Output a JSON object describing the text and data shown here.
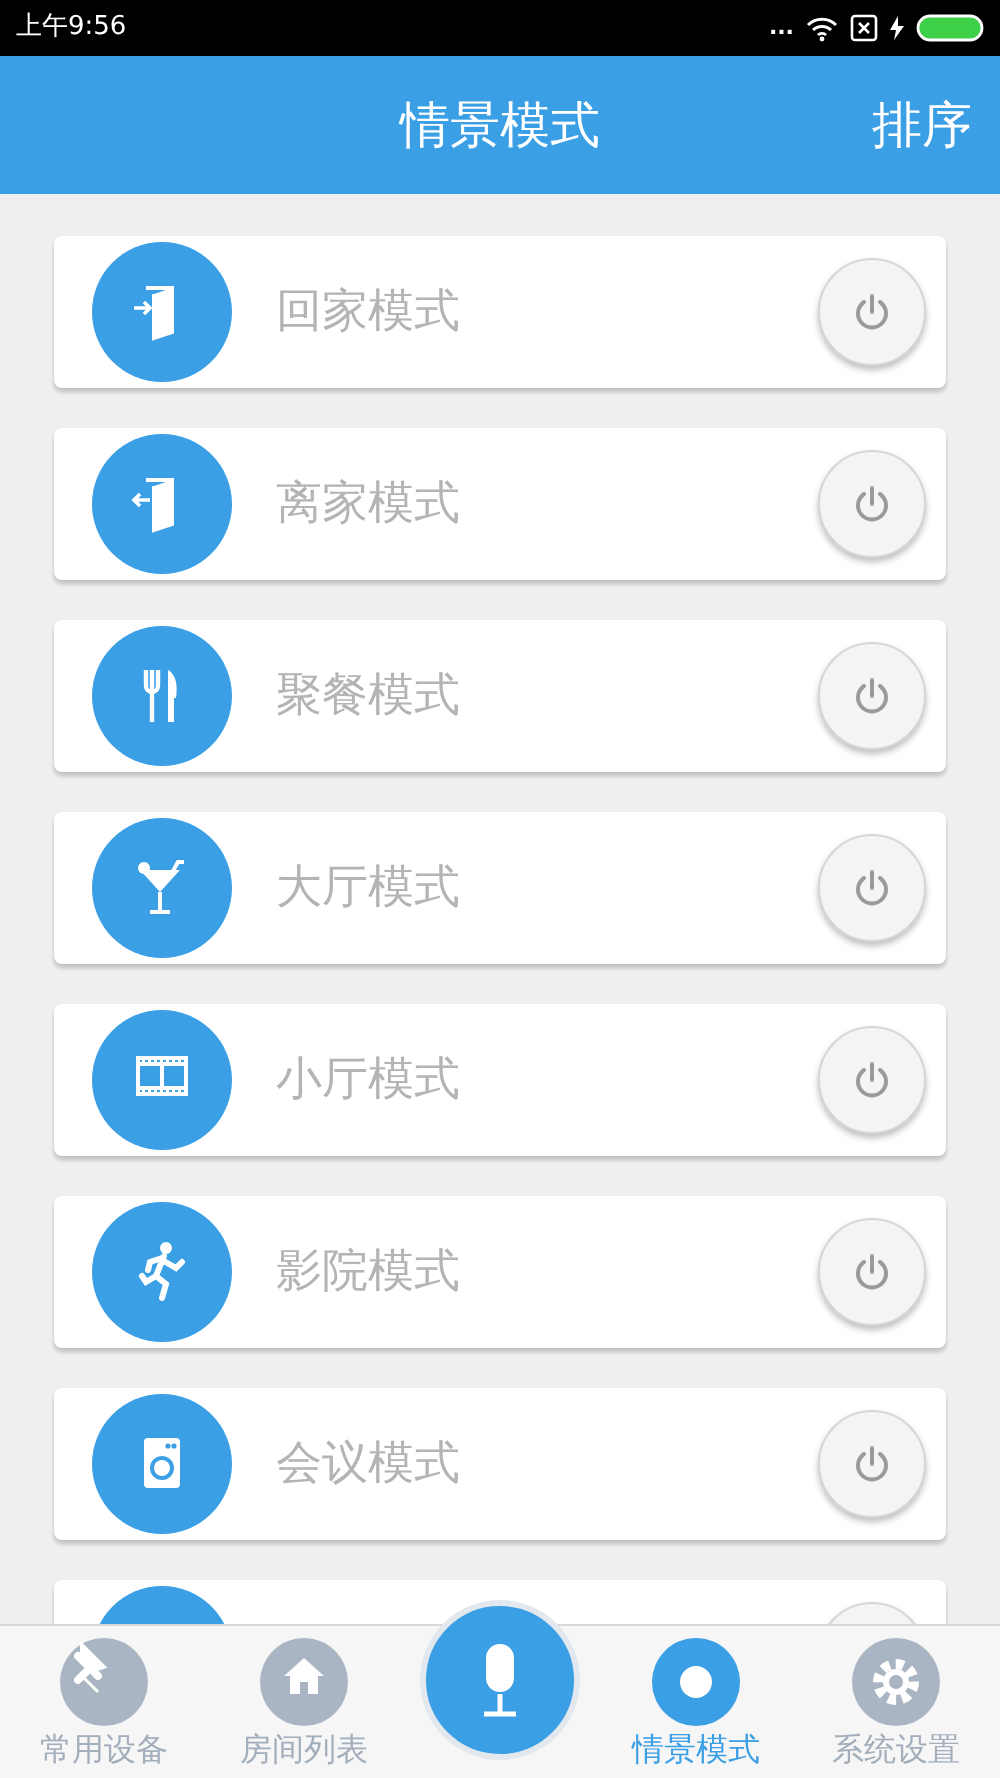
{
  "status_bar": {
    "time": "上午9:56",
    "dots": "..."
  },
  "header": {
    "title": "情景模式",
    "action": "排序"
  },
  "scenes": [
    {
      "label": "回家模式",
      "on": false
    },
    {
      "label": "离家模式",
      "on": false
    },
    {
      "label": "聚餐模式",
      "on": false
    },
    {
      "label": "大厅模式",
      "on": false
    },
    {
      "label": "小厅模式",
      "on": false
    },
    {
      "label": "影院模式",
      "on": false
    },
    {
      "label": "会议模式",
      "on": false
    },
    {
      "on": false
    }
  ],
  "tabs": [
    {
      "kind": "tab",
      "label": "常用设备",
      "selected": false
    },
    {
      "kind": "tab",
      "label": "房间列表",
      "selected": false
    },
    {
      "kind": "center"
    },
    {
      "kind": "tab",
      "label": "情景模式",
      "selected": true
    },
    {
      "kind": "tab",
      "label": "系统设置",
      "selected": false
    }
  ]
}
